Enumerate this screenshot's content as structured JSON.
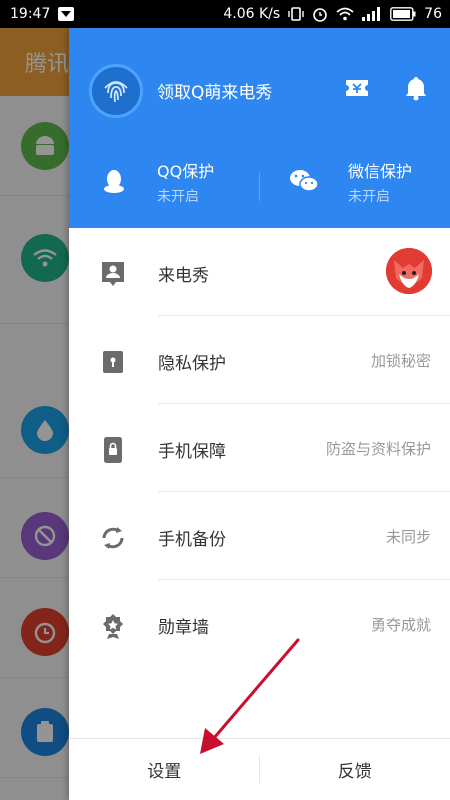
{
  "status_bar": {
    "time": "19:47",
    "speed": "4.06 K/s",
    "battery": "76"
  },
  "background_app": {
    "title": "腾讯"
  },
  "drawer": {
    "header": {
      "title": "领取Q萌来电秀",
      "qq": {
        "title": "QQ保护",
        "status": "未开启"
      },
      "wechat": {
        "title": "微信保护",
        "status": "未开启"
      }
    },
    "menu": [
      {
        "label": "来电秀",
        "value": ""
      },
      {
        "label": "隐私保护",
        "value": "加锁秘密"
      },
      {
        "label": "手机保障",
        "value": "防盗与资料保护"
      },
      {
        "label": "手机备份",
        "value": "未同步"
      },
      {
        "label": "勋章墙",
        "value": "勇夺成就"
      }
    ],
    "bottom": {
      "settings": "设置",
      "feedback": "反馈"
    }
  },
  "colors": {
    "header_blue": "#2e86f0",
    "annotation_red": "#c8102e"
  }
}
